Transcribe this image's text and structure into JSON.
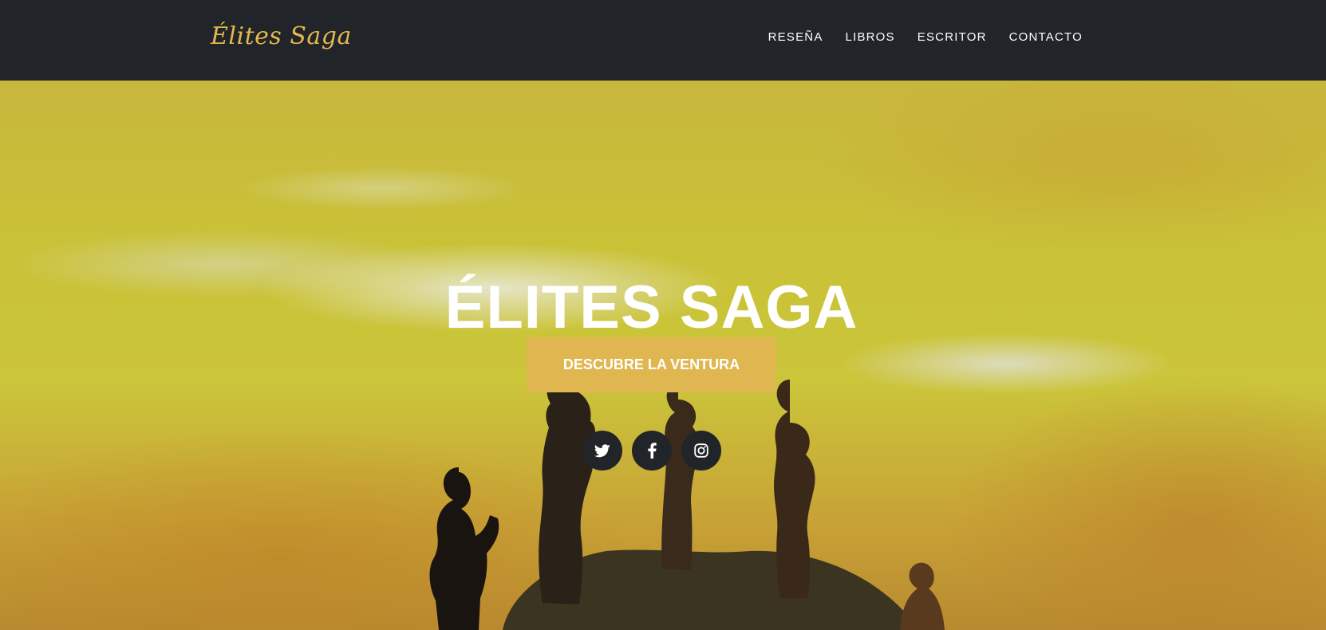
{
  "nav": {
    "brand": "Élites Saga",
    "links": [
      {
        "label": "RESEÑA"
      },
      {
        "label": "LIBROS"
      },
      {
        "label": "ESCRITOR"
      },
      {
        "label": "CONTACTO"
      }
    ]
  },
  "hero": {
    "title": "ÉLITES SAGA",
    "cta_label": "DESCUBRE LA VENTURA",
    "social": [
      {
        "icon": "twitter-icon"
      },
      {
        "icon": "facebook-icon"
      },
      {
        "icon": "instagram-icon"
      }
    ]
  },
  "colors": {
    "navbar_bg": "#212529",
    "accent": "#e0b651",
    "brand": "#e5b84e",
    "text_light": "#ffffff"
  }
}
